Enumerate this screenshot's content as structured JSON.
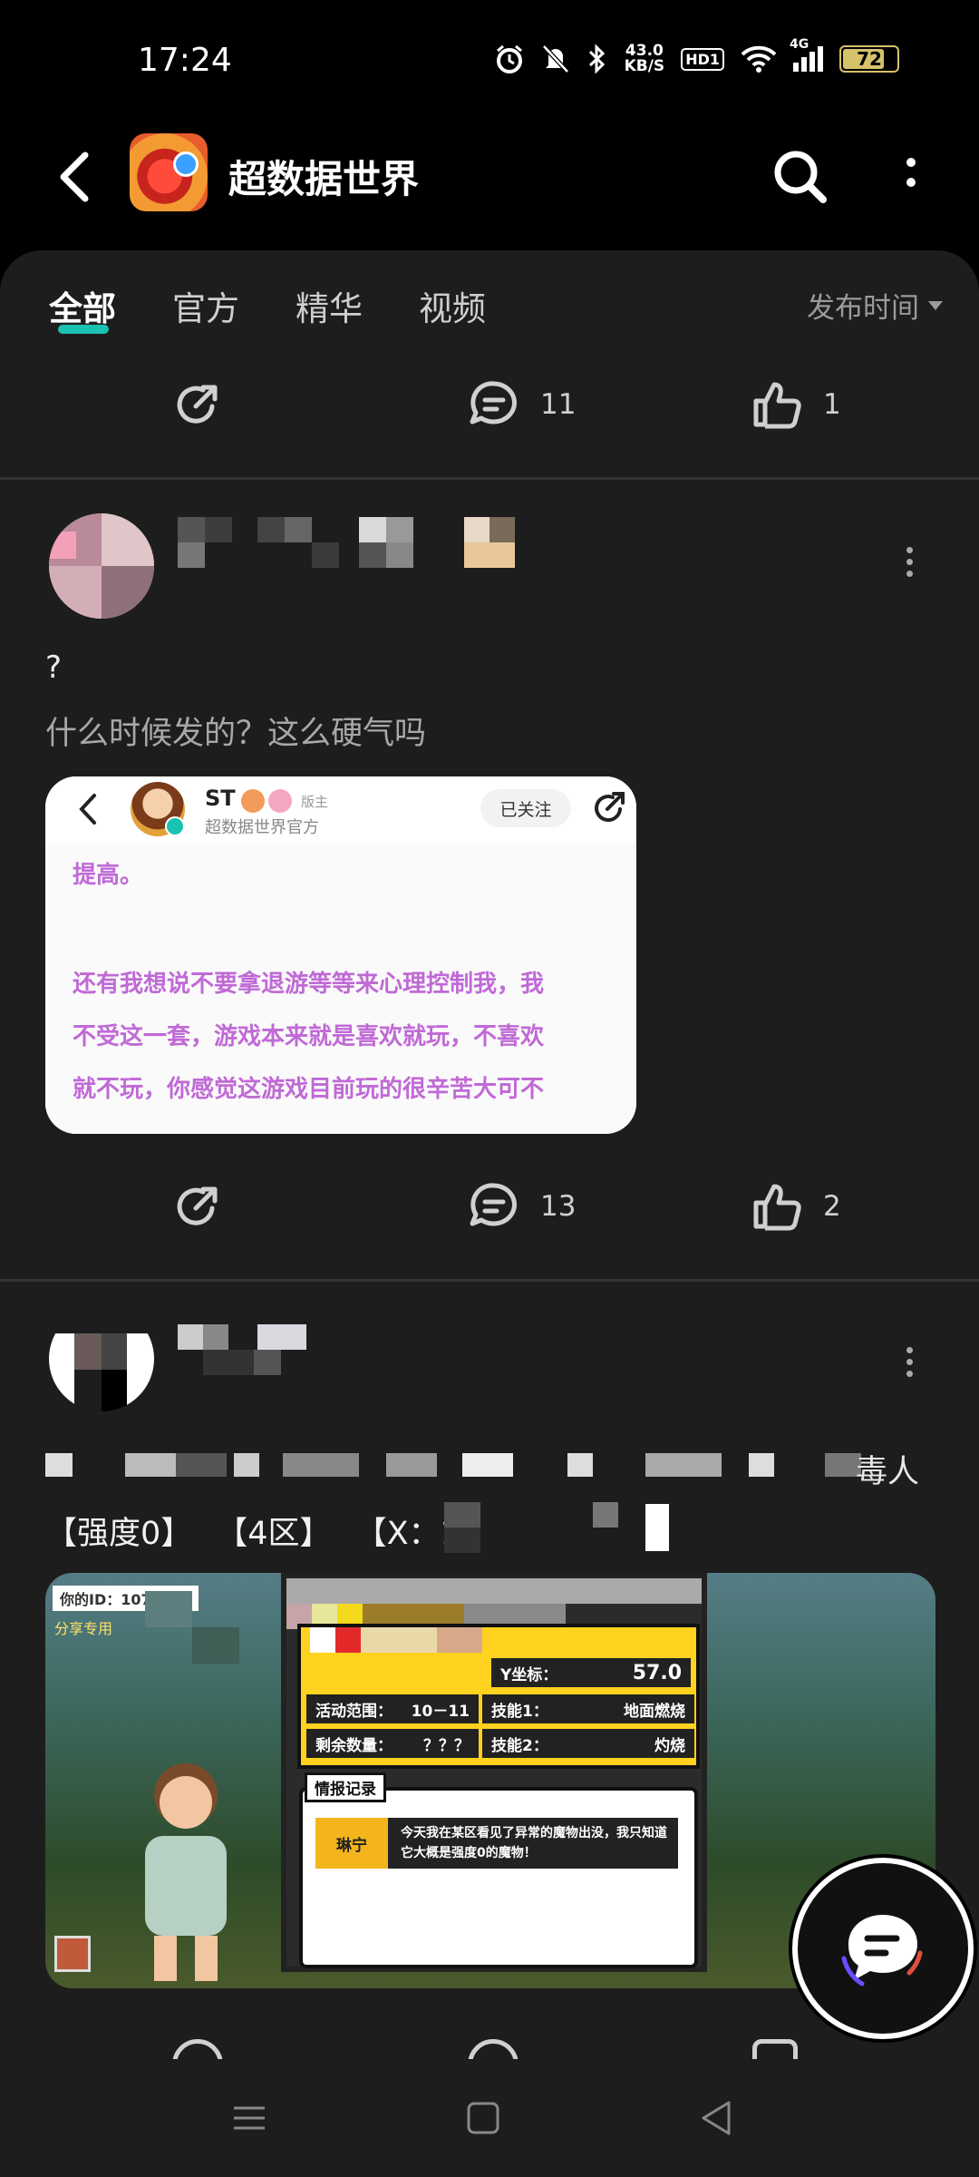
{
  "status_bar": {
    "time": "17:24",
    "net_speed_value": "43.0",
    "net_speed_unit": "KB/S",
    "hd_label": "HD1",
    "signal_label": "4G",
    "battery_level": "72",
    "battery_color": "#d6c26a"
  },
  "header": {
    "title": "超数据世界",
    "back_icon": "back-arrow-icon",
    "search_icon": "search-icon",
    "more_icon": "more-vertical-icon"
  },
  "tabs": {
    "items": [
      "全部",
      "官方",
      "精华",
      "视频"
    ],
    "active_index": 0,
    "sort_label": "发布时间",
    "accent": "#19c2b1"
  },
  "post1": {
    "comment_count": "11",
    "like_count": "1"
  },
  "post2": {
    "title": "?",
    "text": "什么时候发的？这么硬气吗",
    "embedded": {
      "name": "ST",
      "role": "版主",
      "subtitle": "超数据世界官方",
      "follow_label": "已关注",
      "lines": [
        "提高。",
        "还有我想说不要拿退游等等来心理控制我，我",
        "不受这一套，游戏本来就是喜欢就玩，不喜欢",
        "就不玩，你感觉这游戏目前玩的很辛苦大可不"
      ],
      "text_color": "#c06ad6"
    },
    "comment_count": "13",
    "like_count": "2"
  },
  "post3": {
    "text_tail": "毒人",
    "tags": [
      "【强度0】",
      "【4区】",
      "【X：14"
    ],
    "game_image": {
      "id_label": "你的ID：1071837",
      "corner_label": "分享专用",
      "y_label": "Y坐标：",
      "y_value": "57.0",
      "range_label": "活动范围：",
      "range_value": "10－11",
      "skill1_label": "技能1：",
      "skill1_value": "地面燃烧",
      "remain_label": "剩余数量：",
      "remain_value": "？？？",
      "skill2_label": "技能2：",
      "skill2_value": "灼烧",
      "info_title": "情报记录",
      "info_name": "琳宁",
      "info_text": "今天我在某区看见了异常的魔物出没，我只知道它大概是强度0的魔物！"
    }
  }
}
